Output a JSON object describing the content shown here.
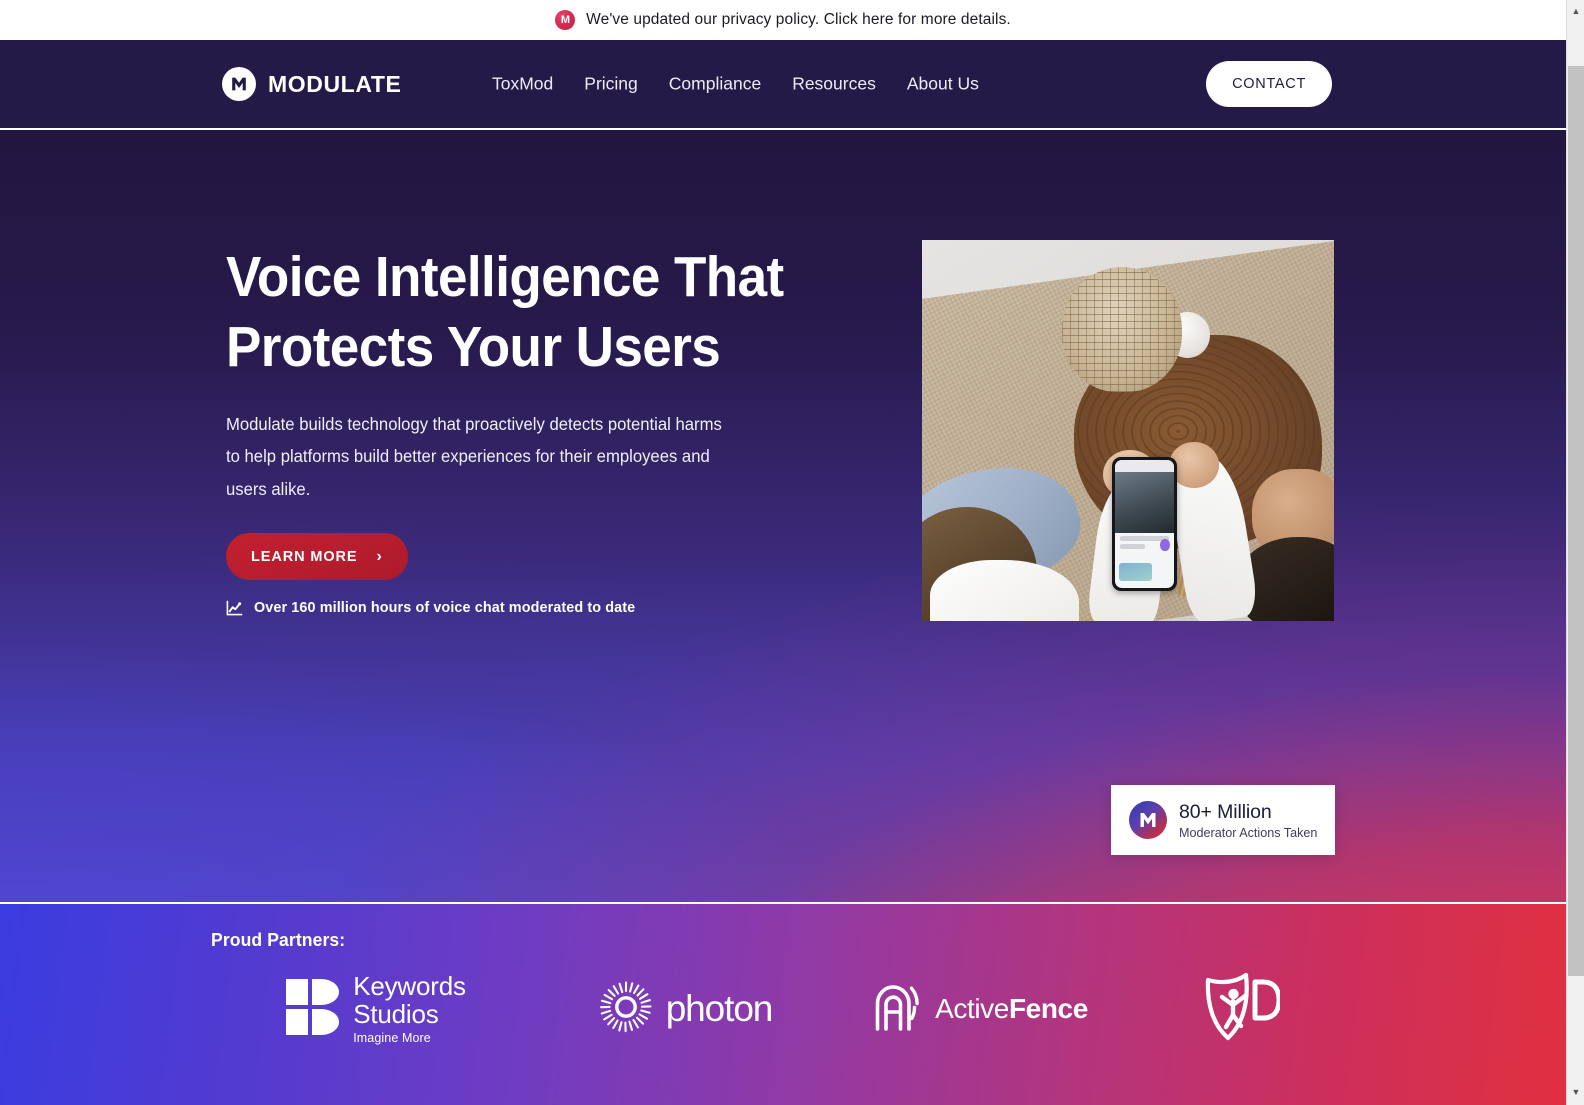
{
  "announcement": {
    "logo_icon": "modulate-m-icon",
    "text": "We've updated our privacy policy. Click here for more details."
  },
  "header": {
    "brand_name": "MODULATE",
    "brand_icon": "modulate-m-logo-icon",
    "nav": [
      {
        "label": "ToxMod"
      },
      {
        "label": "Pricing"
      },
      {
        "label": "Compliance"
      },
      {
        "label": "Resources"
      },
      {
        "label": "About Us"
      }
    ],
    "contact_label": "CONTACT",
    "background_color": "#241a47"
  },
  "hero": {
    "title": "Voice Intelligence That Protects Your Users",
    "subtitle": "Modulate builds technology that proactively detects potential harms to help platforms build better experiences for their employees and users alike.",
    "cta_label": "LEARN MORE",
    "cta_chevron_icon": "chevron-right-icon",
    "cta_color": "#bb1f2e",
    "stat_icon": "trend-chart-icon",
    "stat_text": "Over 160 million hours of voice chat moderated to date",
    "photo_alt": "Top-down photo of two people sitting on a jute rug around a wooden stump table looking at a phone"
  },
  "badge": {
    "icon": "modulate-m-gradient-icon",
    "value": "80+ Million",
    "label": "Moderator Actions Taken"
  },
  "partners": {
    "title": "Proud Partners:",
    "logos": [
      {
        "name": "Keywords Studios",
        "icon": "keywords-studios-icon",
        "line1": "Keywords",
        "line2": "Studios",
        "tagline": "Imagine More"
      },
      {
        "name": "photon",
        "icon": "photon-burst-icon",
        "wordmark": "photon"
      },
      {
        "name": "ActiveFence",
        "icon": "activefence-arch-icon",
        "wordmark_light": "Active",
        "wordmark_bold": "Fence"
      },
      {
        "name": "k-ID",
        "icon": "kid-shield-icon"
      }
    ],
    "gradient_start": "#3a3ce0",
    "gradient_end": "#e0303f"
  },
  "scrollbar": {
    "up_arrow_icon": "scroll-up-arrow-icon",
    "down_arrow_icon": "scroll-down-arrow-icon"
  }
}
